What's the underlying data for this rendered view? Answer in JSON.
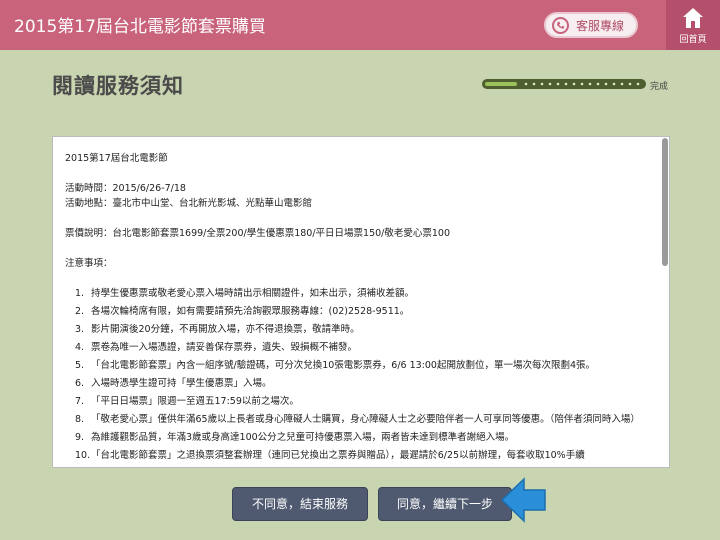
{
  "header": {
    "title": "2015第17屆台北電影節套票購買",
    "service_label": "客服專線",
    "home_label": "回首頁"
  },
  "page": {
    "title": "閱讀服務須知",
    "progress_label": "完成",
    "progress_fraction": 0.2
  },
  "notice": {
    "heading": "2015第17屆台北電影節",
    "period": "活動時間：2015/6/26-7/18",
    "venue": "活動地點：臺北市中山堂、台北新光影城、光點華山電影館",
    "prices": "票價說明：台北電影節套票1699/全票200/學生優惠票180/平日日場票150/敬老愛心票100",
    "notes_title": "注意事項：",
    "items": [
      {
        "num": "1.",
        "text": "持學生優惠票或敬老愛心票入場時請出示相關證件，如未出示，須補收差額。"
      },
      {
        "num": "2.",
        "text": "各場次輪椅席有限，如有需要請預先洽詢觀眾服務專線：(02)2528-9511。"
      },
      {
        "num": "3.",
        "text": "影片開演後20分鐘，不再開放入場，亦不得退換票，敬請準時。"
      },
      {
        "num": "4.",
        "text": "票卷為唯一入場憑證，請妥善保存票券，遺失、毀損概不補發。"
      },
      {
        "num": "5.",
        "text": "「台北電影節套票」內含一組序號/驗證碼，可分次兌換10張電影票券，6/6 13:00起開放劃位，單一場次每次限劃4張。"
      },
      {
        "num": "6.",
        "text": "入場時憑學生證可持「學生優惠票」入場。"
      },
      {
        "num": "7.",
        "text": "「平日日場票」限週一至週五17:59以前之場次。"
      },
      {
        "num": "8.",
        "text": "「敬老愛心票」僅供年滿65歲以上長者或身心障礙人士購買，身心障礙人士之必要陪伴者一人可享同等優惠。（陪伴者須同時入場）"
      },
      {
        "num": "9.",
        "text": "為維護觀影品質，年滿3歲或身高達100公分之兒童可持優惠票入場，兩者皆未達到標準者謝絕入場。"
      },
      {
        "num": "10.",
        "text": "「台北電影節套票」之退換票須整套辦理（連同已兌換出之票券與贈品），最遲請於6/25以前辦理，每套收取10%手續"
      }
    ]
  },
  "buttons": {
    "disagree": "不同意，結束服務",
    "agree": "同意，繼續下一步"
  },
  "colors": {
    "header_bg": "#c9637c",
    "page_bg": "#c9d5b0",
    "button_bg": "#4f5a70",
    "progress_fill": "#9ac25a",
    "pointer": "#2a8fd8"
  },
  "icons": {
    "service": "phone-icon",
    "home": "home-icon",
    "pointer": "arrow-left-icon"
  }
}
